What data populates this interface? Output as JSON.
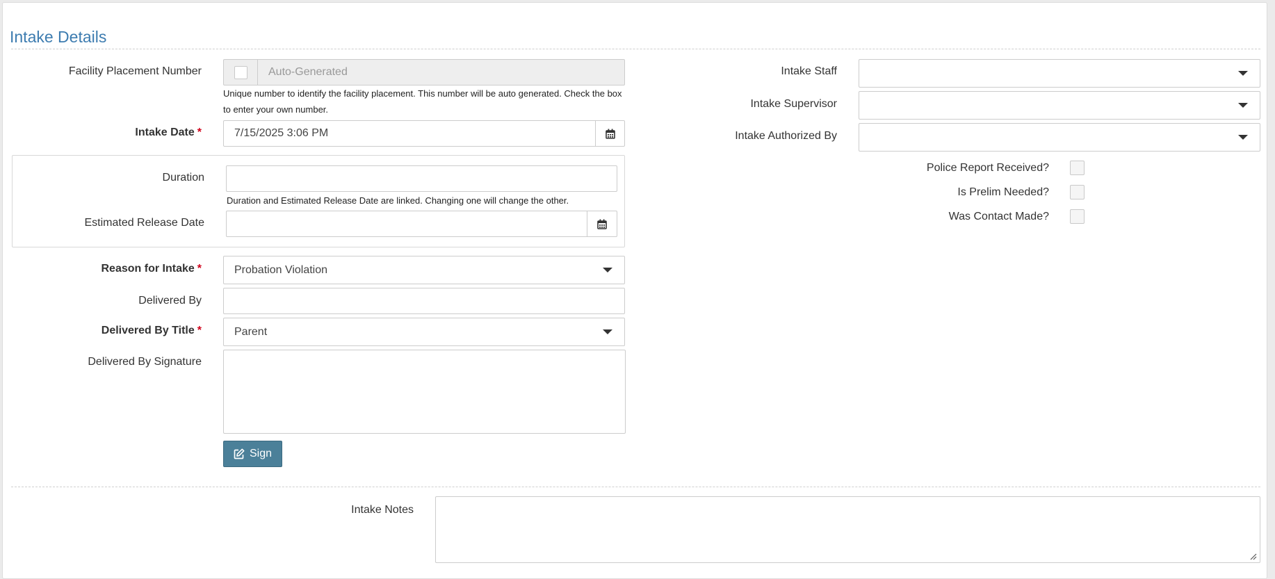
{
  "section": {
    "title": "Intake Details"
  },
  "left": {
    "facility_placement": {
      "label": "Facility Placement Number",
      "placeholder": "Auto-Generated",
      "help": "Unique number to identify the facility placement. This number will be auto generated. Check the box to enter your own number.",
      "own_number_checked": false
    },
    "intake_date": {
      "label": "Intake Date",
      "required_mark": "*",
      "value": "7/15/2025 3:06 PM",
      "icon": "calendar-icon"
    },
    "duration": {
      "label": "Duration",
      "value": "",
      "help": "Duration and Estimated Release Date are linked. Changing one will change the other."
    },
    "estimated_release": {
      "label": "Estimated Release Date",
      "value": "",
      "icon": "calendar-icon"
    },
    "reason_for_intake": {
      "label": "Reason for Intake",
      "required_mark": "*",
      "value": "Probation Violation"
    },
    "delivered_by": {
      "label": "Delivered By",
      "value": ""
    },
    "delivered_by_title": {
      "label": "Delivered By Title",
      "required_mark": "*",
      "value": "Parent"
    },
    "delivered_by_signature": {
      "label": "Delivered By Signature"
    },
    "sign_button": {
      "label": "Sign",
      "icon": "edit-icon"
    }
  },
  "right": {
    "intake_staff": {
      "label": "Intake Staff",
      "value": ""
    },
    "intake_supervisor": {
      "label": "Intake Supervisor",
      "value": ""
    },
    "intake_authorized_by": {
      "label": "Intake Authorized By",
      "value": ""
    },
    "police_report": {
      "label": "Police Report Received?",
      "checked": false
    },
    "prelim_needed": {
      "label": "Is Prelim Needed?",
      "checked": false
    },
    "contact_made": {
      "label": "Was Contact Made?",
      "checked": false
    }
  },
  "notes": {
    "label": "Intake Notes",
    "value": ""
  },
  "colors": {
    "accent": "#3d7cb0",
    "required": "#d0021b",
    "button": "#4b8099"
  }
}
